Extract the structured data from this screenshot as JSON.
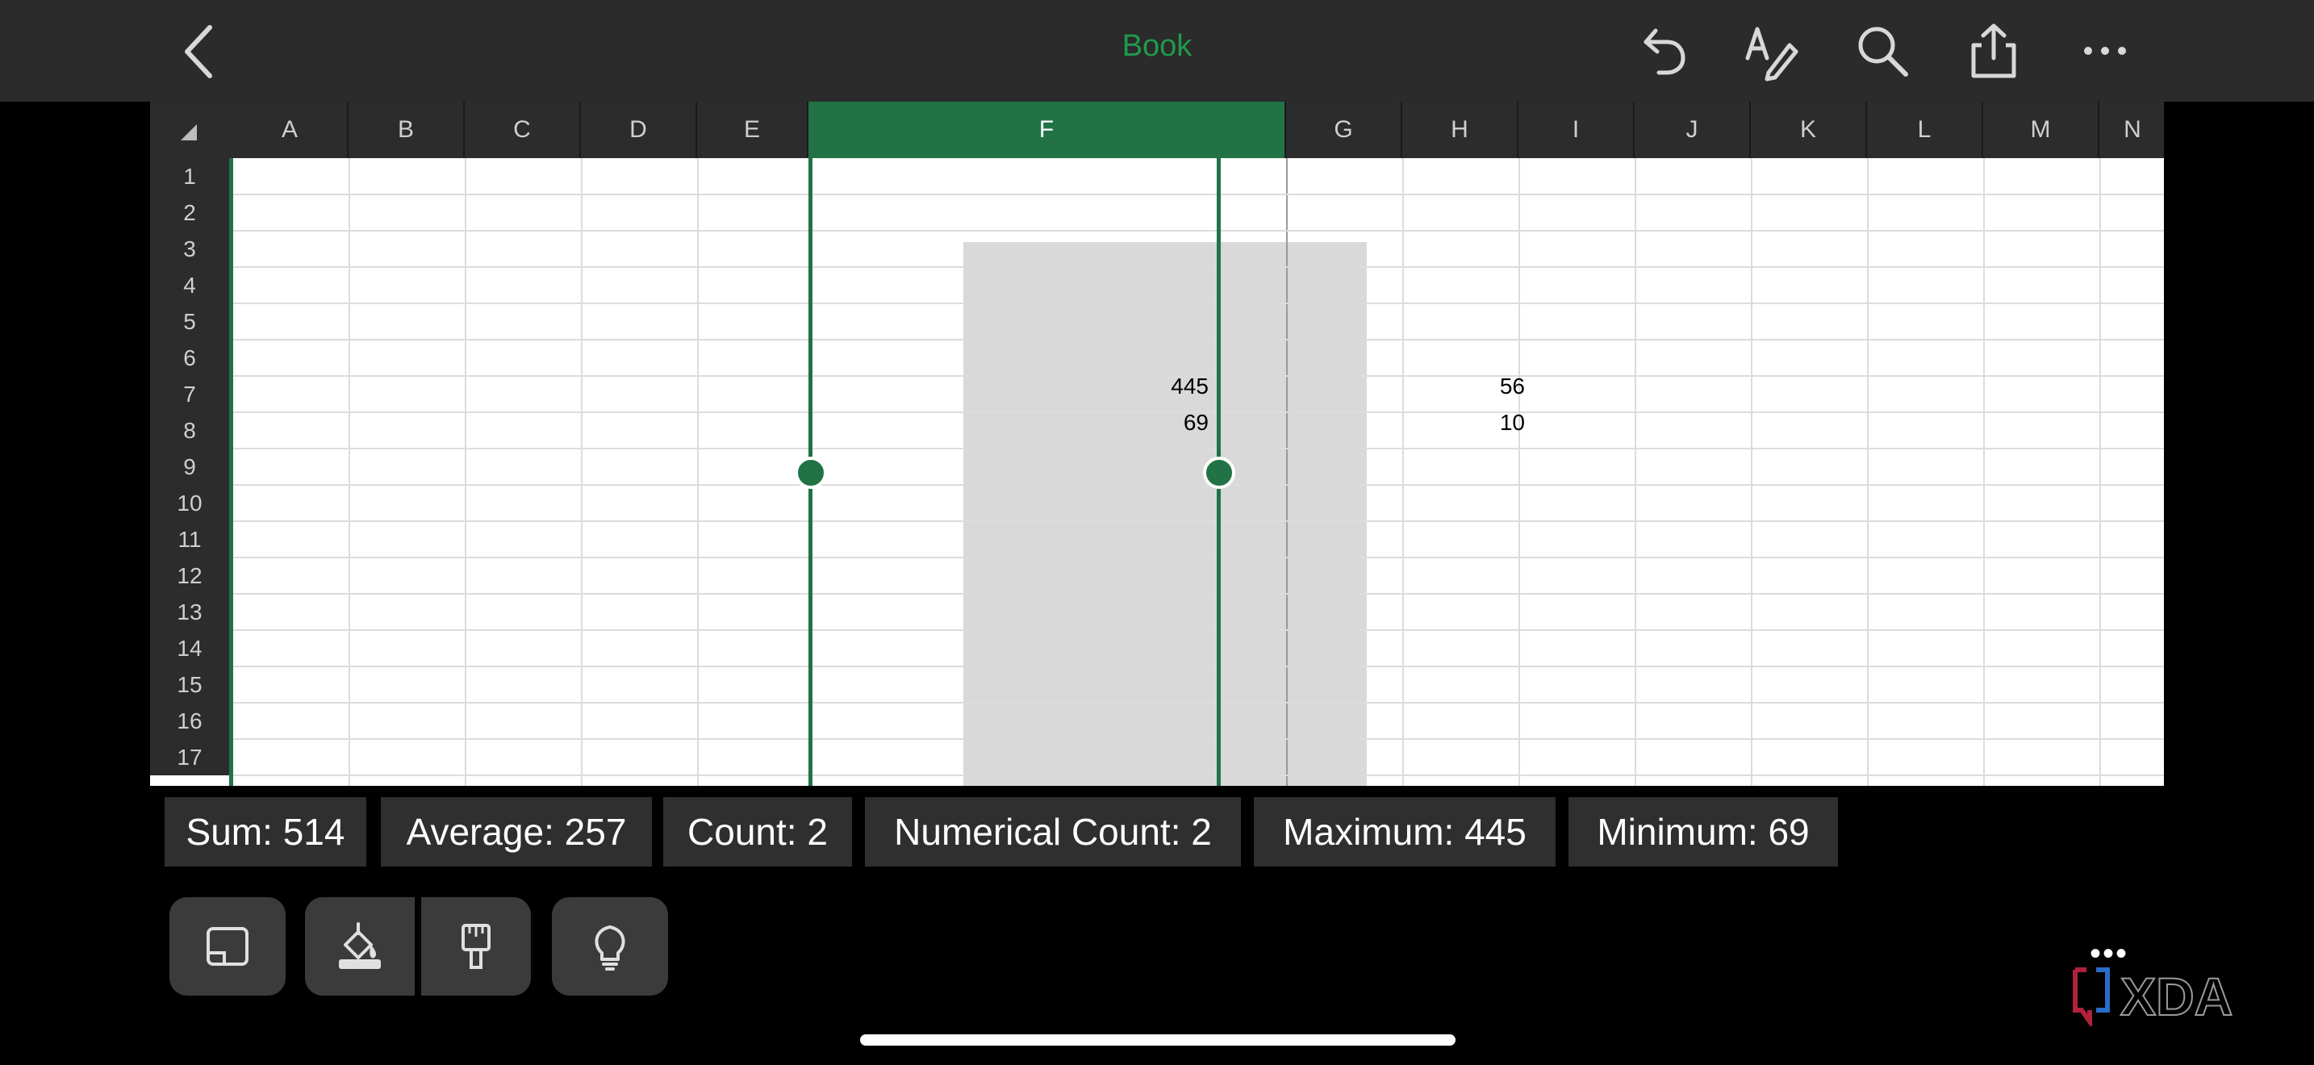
{
  "header": {
    "title": "Book"
  },
  "toolbar_icons": [
    "back-icon",
    "undo-icon",
    "draw-icon",
    "search-icon",
    "share-icon",
    "more-icon"
  ],
  "columns": [
    "A",
    "B",
    "C",
    "D",
    "E",
    "F",
    "G",
    "H",
    "I",
    "J",
    "K",
    "L",
    "M",
    "N"
  ],
  "selected_column": "F",
  "rows": [
    "1",
    "2",
    "3",
    "4",
    "5",
    "6",
    "7",
    "8",
    "9",
    "10",
    "11",
    "12",
    "13",
    "14",
    "15",
    "16",
    "17"
  ],
  "cells": {
    "F7": "445",
    "F8": "69",
    "H7": "56",
    "H8": "10"
  },
  "status": {
    "sum": "Sum: 514",
    "average": "Average: 257",
    "count": "Count: 2",
    "numerical_count": "Numerical Count: 2",
    "maximum": "Maximum: 445",
    "minimum": "Minimum: 69"
  },
  "bottom_toolbar_icons": [
    "keyboard-icon",
    "fill-color-icon",
    "format-painter-icon",
    "ideas-icon"
  ],
  "more_dots": "•••",
  "accent_color": "#217346",
  "title_color": "#1f9a4c"
}
